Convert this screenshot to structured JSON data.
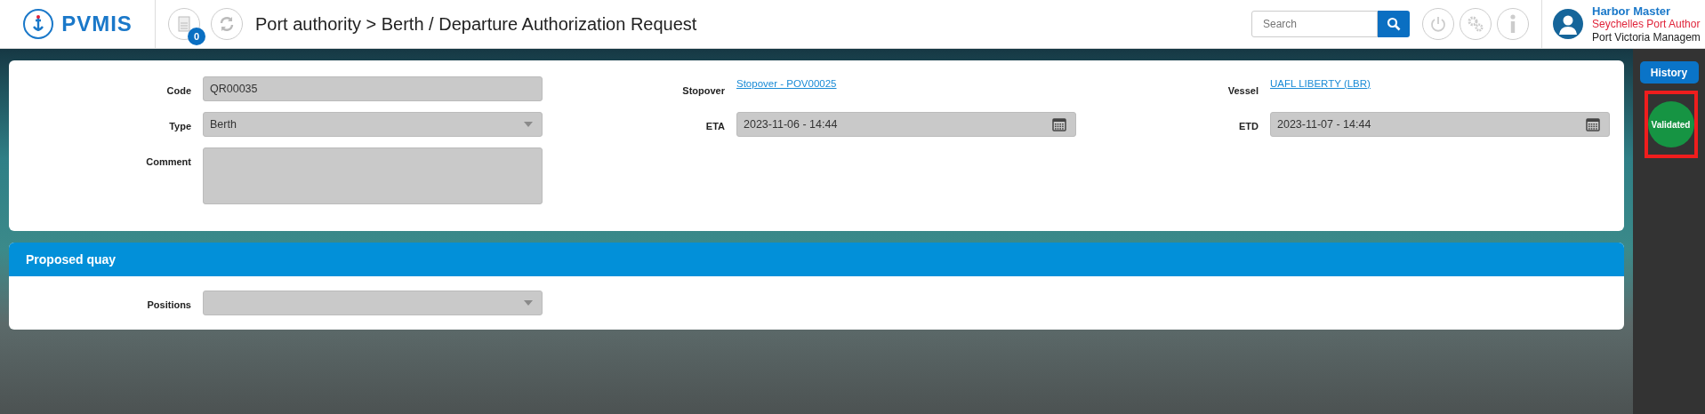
{
  "header": {
    "logo_text": "PVMIS",
    "notification_count": "0",
    "breadcrumb": "Port authority > Berth / Departure Authorization Request",
    "search": {
      "placeholder": "Search"
    },
    "user": {
      "name": "Harbor Master",
      "organization": "Seychelles Port Author",
      "unit": "Port Victoria Managem"
    }
  },
  "form": {
    "fields": [
      {
        "label": "Code",
        "kind": "text",
        "value": "QR00035"
      },
      {
        "label": "Stopover",
        "kind": "link",
        "value": "Stopover - POV00025"
      },
      {
        "label": "Vessel",
        "kind": "link",
        "value": "UAFL LIBERTY (LBR)"
      },
      {
        "label": "Type",
        "kind": "select",
        "value": "Berth"
      },
      {
        "label": "ETA",
        "kind": "date",
        "value": "2023-11-06 - 14:44"
      },
      {
        "label": "ETD",
        "kind": "date",
        "value": "2023-11-07 - 14:44"
      },
      {
        "label": "Comment",
        "kind": "textarea"
      }
    ]
  },
  "proposed_quay": {
    "title": "Proposed quay",
    "fields": [
      {
        "label": "Positions",
        "kind": "select"
      }
    ]
  },
  "sidebar": {
    "history_button": "History",
    "status": "Validated"
  }
}
